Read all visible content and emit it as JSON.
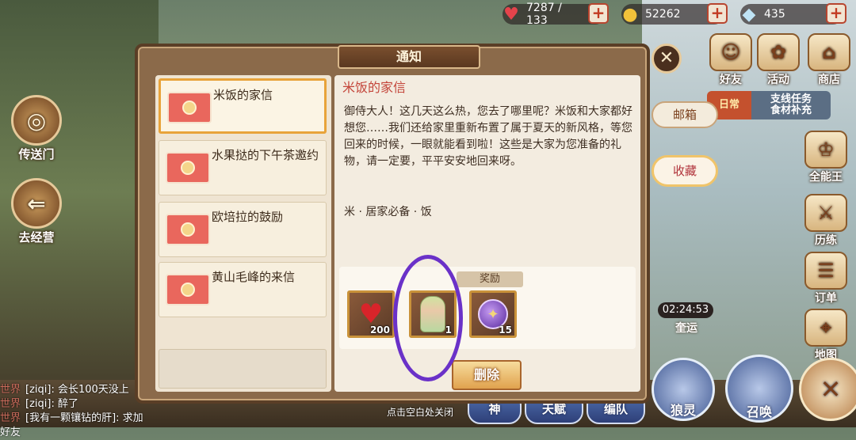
{
  "resources": {
    "hp": "7287 / 133",
    "gold": "52262",
    "gems": "435"
  },
  "left_buttons": {
    "portal": "传送门",
    "goto_business": "去经营"
  },
  "right_buttons": {
    "friends": "好友",
    "events": "活动",
    "shop": "商店",
    "omni": "全能王",
    "history": "历练",
    "orders": "订单",
    "map": "地图"
  },
  "tasks": {
    "daily": "日常",
    "side_line1": "支线任务",
    "side_line2": "食材补充"
  },
  "expedition": {
    "timer": "02:24:53",
    "label": "奎运"
  },
  "bottom_buttons": {
    "god": "神",
    "talent": "天赋",
    "team": "编队",
    "spirit": "狼灵",
    "summon": "召唤"
  },
  "chat": [
    {
      "channel": "世界",
      "text": "[ziqi]: 会长100天没上"
    },
    {
      "channel": "世界",
      "text": "[ziqi]: 醉了"
    },
    {
      "channel": "世界",
      "text": "[我有一颗镶钻的肝]: 求加好友"
    }
  ],
  "dialog": {
    "title": "通知",
    "mail_list": [
      {
        "title": "米饭的家信"
      },
      {
        "title": "水果挞的下午茶邀约"
      },
      {
        "title": "欧培拉的鼓励"
      },
      {
        "title": "黄山毛峰的来信"
      }
    ],
    "content": {
      "title": "米饭的家信",
      "body": "御侍大人！这几天这么热，您去了哪里呢？米饭和大家都好想您……我们还给家里重新布置了属于夏天的新风格，等您回来的时候，一眼就能看到啦！这些是大家为您准备的礼物，请一定要，平平安安地回来呀。",
      "sender": "米 · 居家必备 · 饭"
    },
    "reward_label": "奖励",
    "rewards": [
      {
        "icon": "heart-icon",
        "qty": "200"
      },
      {
        "icon": "character-icon",
        "qty": "1"
      },
      {
        "icon": "orb-icon",
        "qty": "15"
      }
    ],
    "delete_label": "删除",
    "tabs": {
      "mailbox": "邮箱",
      "favorites": "收藏"
    },
    "hint": "点击空白处关闭"
  },
  "colors": {
    "annotation": "#6a31c8",
    "selected_border": "#e8a33a"
  }
}
